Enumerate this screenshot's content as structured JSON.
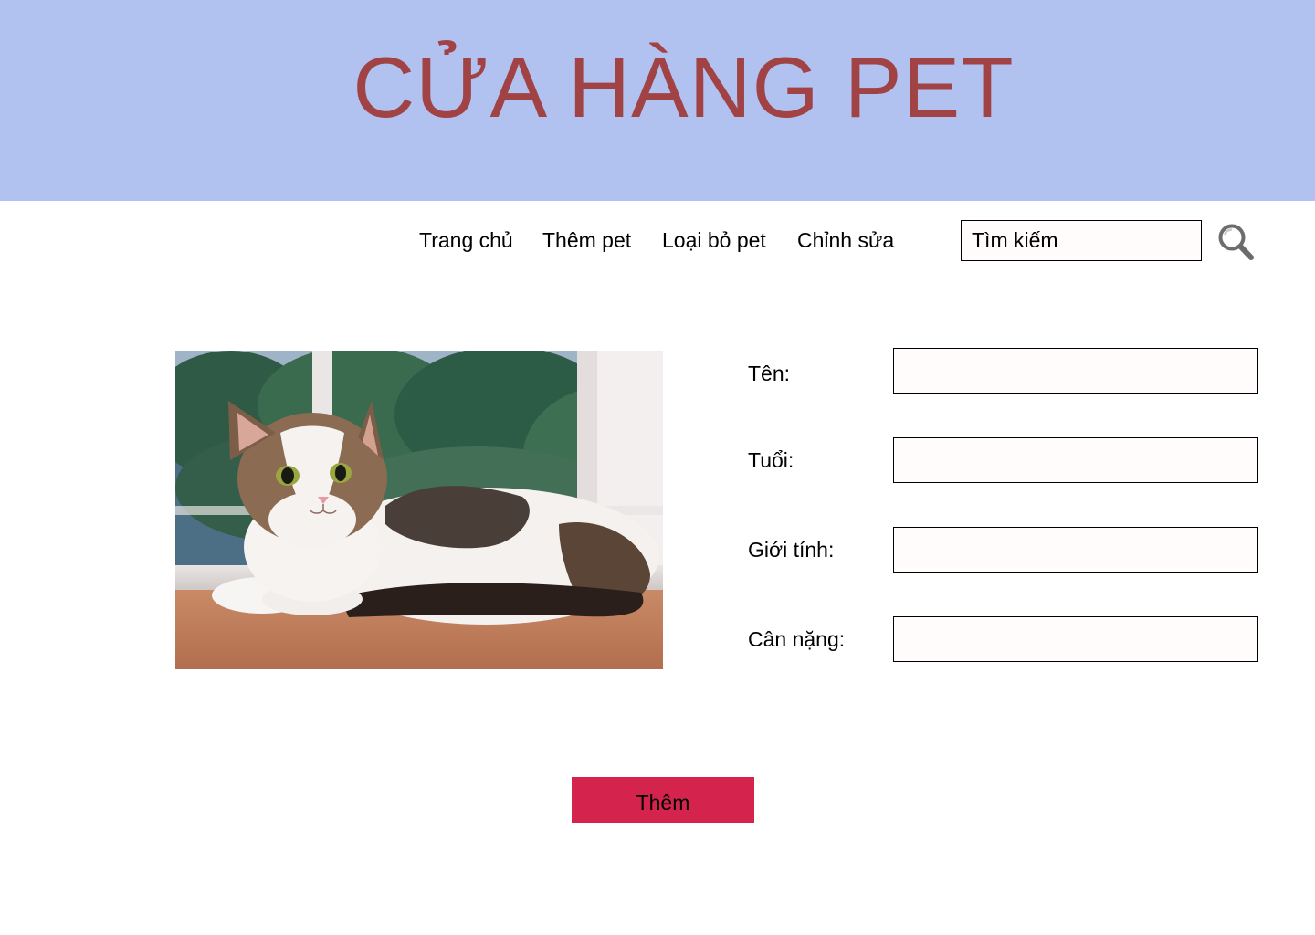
{
  "header": {
    "title": "CỬA HÀNG PET"
  },
  "nav": {
    "items": [
      {
        "label": "Trang chủ"
      },
      {
        "label": "Thêm pet"
      },
      {
        "label": "Loại bỏ pet"
      },
      {
        "label": "Chỉnh sửa"
      }
    ]
  },
  "search": {
    "placeholder": "Tìm kiếm",
    "icon": "search-icon"
  },
  "form": {
    "fields": [
      {
        "label": "Tên:",
        "value": ""
      },
      {
        "label": "Tuổi:",
        "value": ""
      },
      {
        "label": "Giới tính:",
        "value": ""
      },
      {
        "label": "Cân nặng:",
        "value": ""
      }
    ],
    "submit_label": "Thêm"
  },
  "colors": {
    "banner": "#b1c2f1",
    "title": "#a14344",
    "submit": "#d4244d",
    "input_bg": "#fffcfb"
  }
}
